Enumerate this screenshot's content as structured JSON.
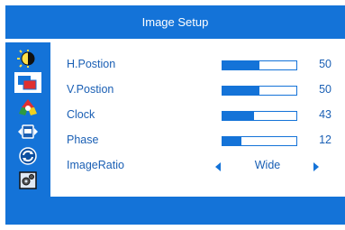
{
  "title": "Image Setup",
  "menu_icons": [
    {
      "name": "brightness-contrast-icon",
      "selected": false
    },
    {
      "name": "image-setup-icon",
      "selected": true
    },
    {
      "name": "color-setup-icon",
      "selected": false
    },
    {
      "name": "osd-setup-icon",
      "selected": false
    },
    {
      "name": "reset-icon",
      "selected": false
    },
    {
      "name": "misc-settings-icon",
      "selected": false
    }
  ],
  "settings": [
    {
      "label": "H.Postion",
      "value": "50",
      "level": 0.5
    },
    {
      "label": "V.Postion",
      "value": "50",
      "level": 0.5
    },
    {
      "label": "Clock",
      "value": "43",
      "level": 0.43
    },
    {
      "label": "Phase",
      "value": "12",
      "level": 0.25
    }
  ],
  "image_ratio": {
    "label": "ImageRatio",
    "value": "Wide"
  },
  "colors": {
    "accent": "#1473d8",
    "text": "#1a5fb4",
    "background": "#ffffff"
  }
}
